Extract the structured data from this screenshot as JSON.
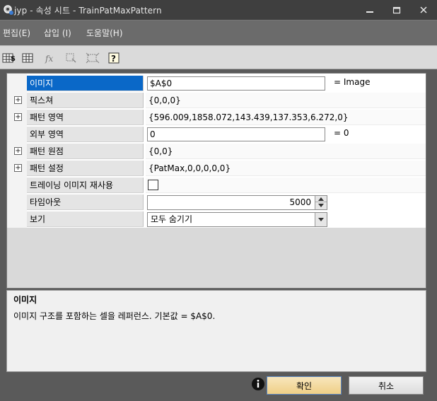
{
  "window": {
    "title": "jyp - 속성 시트 - TrainPatMaxPattern",
    "min_icon": "minimize-icon",
    "max_icon": "maximize-icon",
    "close_icon": "close-icon"
  },
  "menu": {
    "items": [
      {
        "label": "편집(E)"
      },
      {
        "label": "삽입 (I)"
      },
      {
        "label": "도움말(H)"
      }
    ]
  },
  "toolbar": {
    "tools": [
      {
        "icon": "spreadsheet-dollar-icon"
      },
      {
        "icon": "grid-table-icon"
      },
      {
        "icon": "function-fx-icon"
      },
      {
        "icon": "select-cell-icon"
      },
      {
        "icon": "select-region-icon"
      },
      {
        "icon": "help-icon"
      }
    ]
  },
  "properties": {
    "rows": [
      {
        "name": "이미지",
        "value": "$A$0",
        "suffix": "= Image",
        "kind": "edit",
        "selected": true
      },
      {
        "name": "픽스쳐",
        "value": "{0,0,0}",
        "kind": "expand"
      },
      {
        "name": "패턴 영역",
        "value": "{596.009,1858.072,143.439,137.353,6.272,0}",
        "kind": "expand"
      },
      {
        "name": "외부 영역",
        "value": "0",
        "suffix": "= 0",
        "kind": "edit"
      },
      {
        "name": "패턴 원점",
        "value": "{0,0}",
        "kind": "expand"
      },
      {
        "name": "패턴 설정",
        "value": "{PatMax,0,0,0,0,0}",
        "kind": "expand"
      },
      {
        "name": "트레이닝 이미지 재사용",
        "value": "",
        "kind": "checkbox",
        "checked": false
      },
      {
        "name": "타임아웃",
        "value": "5000",
        "kind": "spin"
      },
      {
        "name": "보기",
        "value": "모두 숨기기",
        "kind": "combo"
      }
    ]
  },
  "description": {
    "title": "이미지",
    "text": "이미지 구조를 포함하는 셀을 레퍼런스. 기본값 = $A$0."
  },
  "buttons": {
    "ok": "확인",
    "cancel": "취소"
  },
  "colors": {
    "selection": "#0a68c8",
    "ok_button": "#efcf86",
    "title_bar": "#3f3f3f",
    "menu_bar": "#6b6b6b"
  }
}
